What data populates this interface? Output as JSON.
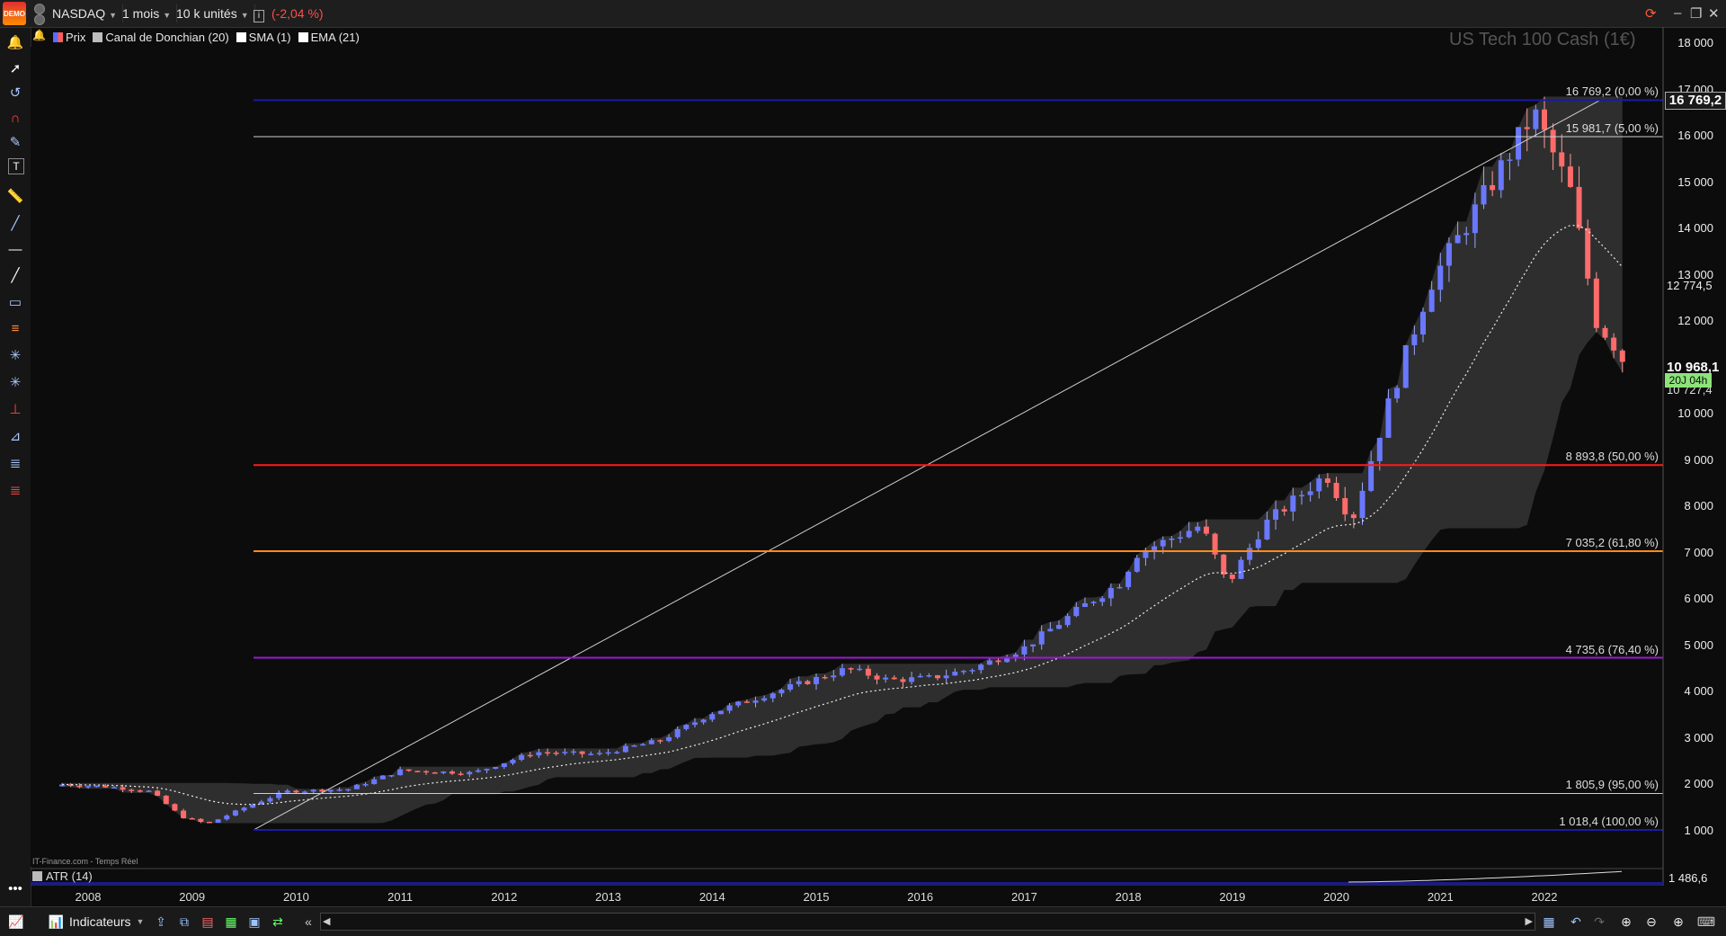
{
  "toolbar": {
    "demo_label": "DEMO",
    "instrument": "NASDAQ",
    "period": "1 mois",
    "units": "10 k unités",
    "info_icon": "i",
    "change": "(-2,04 %)",
    "change_color": "#ff4c4c"
  },
  "legend": [
    {
      "label": "Prix",
      "color": "#5b6bff"
    },
    {
      "label": "Canal de Donchian (20)",
      "color": "#bdbdbd"
    },
    {
      "label": "SMA (1)",
      "color": "#ffffff"
    },
    {
      "label": "EMA (21)",
      "color": "#ffffff"
    }
  ],
  "chart": {
    "watermark": "US Tech 100 Cash (1€)",
    "source": "IT-Finance.com - Temps Réel",
    "current_price_label": "16 769,2",
    "level_12774": "12 774,5",
    "level_10968": "10 968,1",
    "level_10727": "10 727,4",
    "countdown": "20J 04h",
    "atr_label": "ATR (14)",
    "atr_value": "1 486,6"
  },
  "fib_levels": [
    {
      "price": 16769.2,
      "label": "16 769,2 (0,00 %)",
      "color": "#1a1aaa"
    },
    {
      "price": 15981.7,
      "label": "15 981,7 (5,00 %)",
      "color": "#cfcfcf"
    },
    {
      "price": 8893.8,
      "label": "8 893,8 (50,00 %)",
      "color": "#ff1a1a"
    },
    {
      "price": 7035.2,
      "label": "7 035,2 (61,80 %)",
      "color": "#ff8c1a"
    },
    {
      "price": 4735.6,
      "label": "4 735,6 (76,40 %)",
      "color": "#9a1ad0"
    },
    {
      "price": 1805.9,
      "label": "1 805,9 (95,00 %)",
      "color": "#cfcfcf"
    },
    {
      "price": 1018.4,
      "label": "1 018,4 (100,00 %)",
      "color": "#1a1aaa"
    }
  ],
  "price_axis": [
    "18 000",
    "17 000",
    "16 000",
    "15 000",
    "14 000",
    "13 000",
    "12 000",
    "10 000",
    "9 000",
    "8 000",
    "7 000",
    "6 000",
    "5 000",
    "4 000",
    "3 000",
    "2 000",
    "1 000"
  ],
  "years": [
    "2008",
    "2009",
    "2010",
    "2011",
    "2012",
    "2013",
    "2014",
    "2015",
    "2016",
    "2017",
    "2018",
    "2019",
    "2020",
    "2021",
    "2022"
  ],
  "bottom": {
    "indicators_label": "Indicateurs"
  },
  "chart_data": {
    "type": "candlestick",
    "title": "US Tech 100 Cash (1€)",
    "ylim": [
      0,
      18000
    ],
    "x": [
      "2008",
      "2009",
      "2010",
      "2011",
      "2012",
      "2013",
      "2014",
      "2015",
      "2016",
      "2017",
      "2018",
      "2019",
      "2020",
      "2021",
      "2022"
    ],
    "monthly_close_anchors": [
      {
        "year": 2007.75,
        "close": 2000
      },
      {
        "year": 2008.2,
        "close": 1950
      },
      {
        "year": 2008.6,
        "close": 1850
      },
      {
        "year": 2008.9,
        "close": 1300
      },
      {
        "year": 2009.15,
        "close": 1150
      },
      {
        "year": 2009.5,
        "close": 1500
      },
      {
        "year": 2009.9,
        "close": 1850
      },
      {
        "year": 2010.5,
        "close": 1900
      },
      {
        "year": 2011.0,
        "close": 2300
      },
      {
        "year": 2011.7,
        "close": 2250
      },
      {
        "year": 2012.3,
        "close": 2700
      },
      {
        "year": 2012.9,
        "close": 2650
      },
      {
        "year": 2013.5,
        "close": 2950
      },
      {
        "year": 2014.0,
        "close": 3550
      },
      {
        "year": 2014.6,
        "close": 4000
      },
      {
        "year": 2015.3,
        "close": 4500
      },
      {
        "year": 2015.7,
        "close": 4250
      },
      {
        "year": 2016.1,
        "close": 4300
      },
      {
        "year": 2016.5,
        "close": 4500
      },
      {
        "year": 2017.0,
        "close": 4950
      },
      {
        "year": 2017.6,
        "close": 5900
      },
      {
        "year": 2017.95,
        "close": 6400
      },
      {
        "year": 2018.05,
        "close": 6950
      },
      {
        "year": 2018.7,
        "close": 7600
      },
      {
        "year": 2018.95,
        "close": 6300
      },
      {
        "year": 2019.3,
        "close": 7600
      },
      {
        "year": 2019.9,
        "close": 8700
      },
      {
        "year": 2020.15,
        "close": 7700
      },
      {
        "year": 2020.5,
        "close": 10200
      },
      {
        "year": 2020.9,
        "close": 12800
      },
      {
        "year": 2021.5,
        "close": 15000
      },
      {
        "year": 2021.9,
        "close": 16500
      },
      {
        "year": 2022.25,
        "close": 14800
      },
      {
        "year": 2022.5,
        "close": 12000
      },
      {
        "year": 2022.7,
        "close": 11400
      },
      {
        "year": 2022.8,
        "close": 10968
      }
    ],
    "last_close": 10968.1
  }
}
